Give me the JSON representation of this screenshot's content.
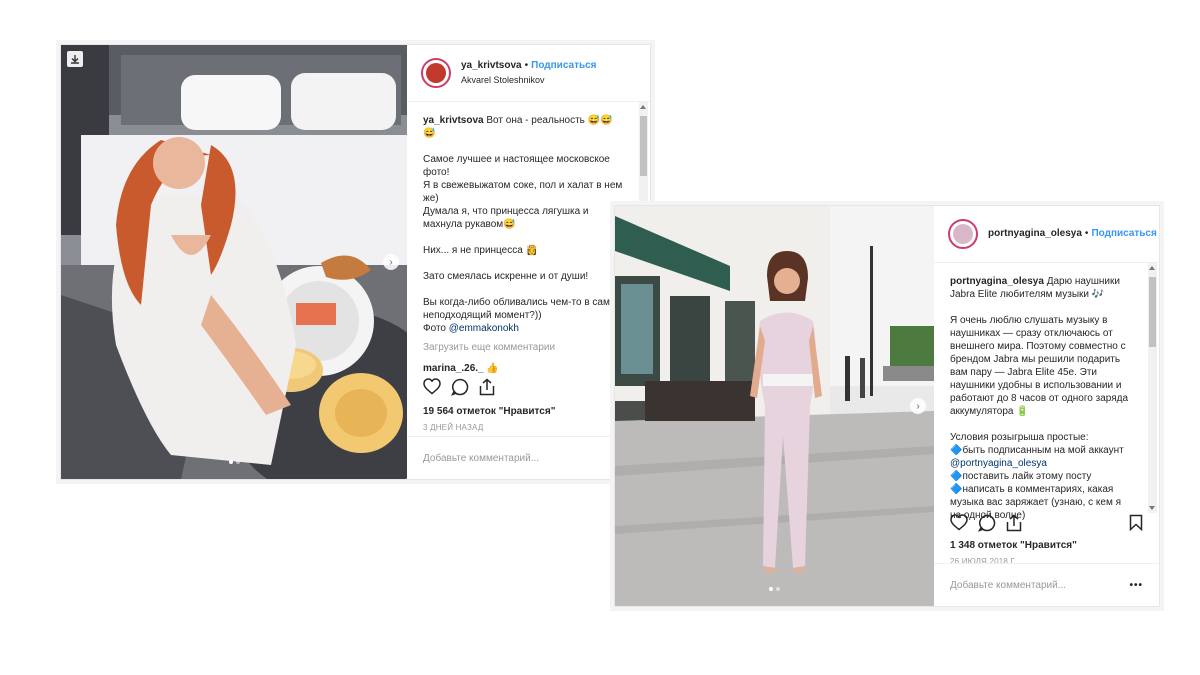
{
  "post1": {
    "username": "ya_krivtsova",
    "follow_label": "Подписаться",
    "location": "Akvarel Stoleshnikov",
    "caption_user": "ya_krivtsova",
    "caption": "Вот она - реальность 😅😅\n😅\n\nСамое лучшее и настоящее московское фото!\nЯ в свежевыжатом соке, пол и халат в нем же)\nДумала я, что принцесса лягушка и махнула рукавом😅\n\nНих... я не принцесса 👸\n\nЗато смеялась искренне и от души!\n\nВы когда-либо обливались чем-то в самый неподходящий момент?))\nФото ",
    "caption_mention": "@emmakonokh",
    "load_more": "Загрузить еще комментарии",
    "comment_user": "marina_.26._",
    "comment_text": "👍",
    "likes": "19 564 отметок \"Нравится\"",
    "date": "3 дней назад",
    "add_comment_placeholder": "Добавьте комментарий..."
  },
  "post2": {
    "username": "portnyagina_olesya",
    "follow_label": "Подписаться",
    "caption_user": "portnyagina_olesya",
    "caption": "Дарю наушники Jabra Elite любителям музыки 🎶\n\nЯ очень люблю слушать музыку в наушниках — сразу отключаюсь от внешнего мира. Поэтому совместно с брендом Jabra мы решили подарить вам пару — Jabra Elite 45e. Эти наушники удобны в использовании и работают до 8 часов от одного заряда аккумулятора 🔋\n\nУсловия розыгрыша простые:\n🔷быть подписанным на мой аккаунт ",
    "caption_mention": "@portnyagina_olesya",
    "caption_rest": "\n🔷поставить лайк этому посту\n🔷написать в комментариях, какая музыка вас заряжает (узнаю, с кем я на одной волне)",
    "likes": "1 348 отметок \"Нравится\"",
    "date": "26 июля 2018 г.",
    "add_comment_placeholder": "Добавьте комментарий...",
    "more_options": "•••"
  },
  "icons": [
    "download-icon",
    "heart-icon",
    "comment-icon",
    "share-icon",
    "bookmark-icon",
    "chevron-right-icon"
  ],
  "colors": {
    "link": "#3897f0",
    "mention": "#003569",
    "story_ring": "#d03b6b",
    "muted": "#999999"
  }
}
